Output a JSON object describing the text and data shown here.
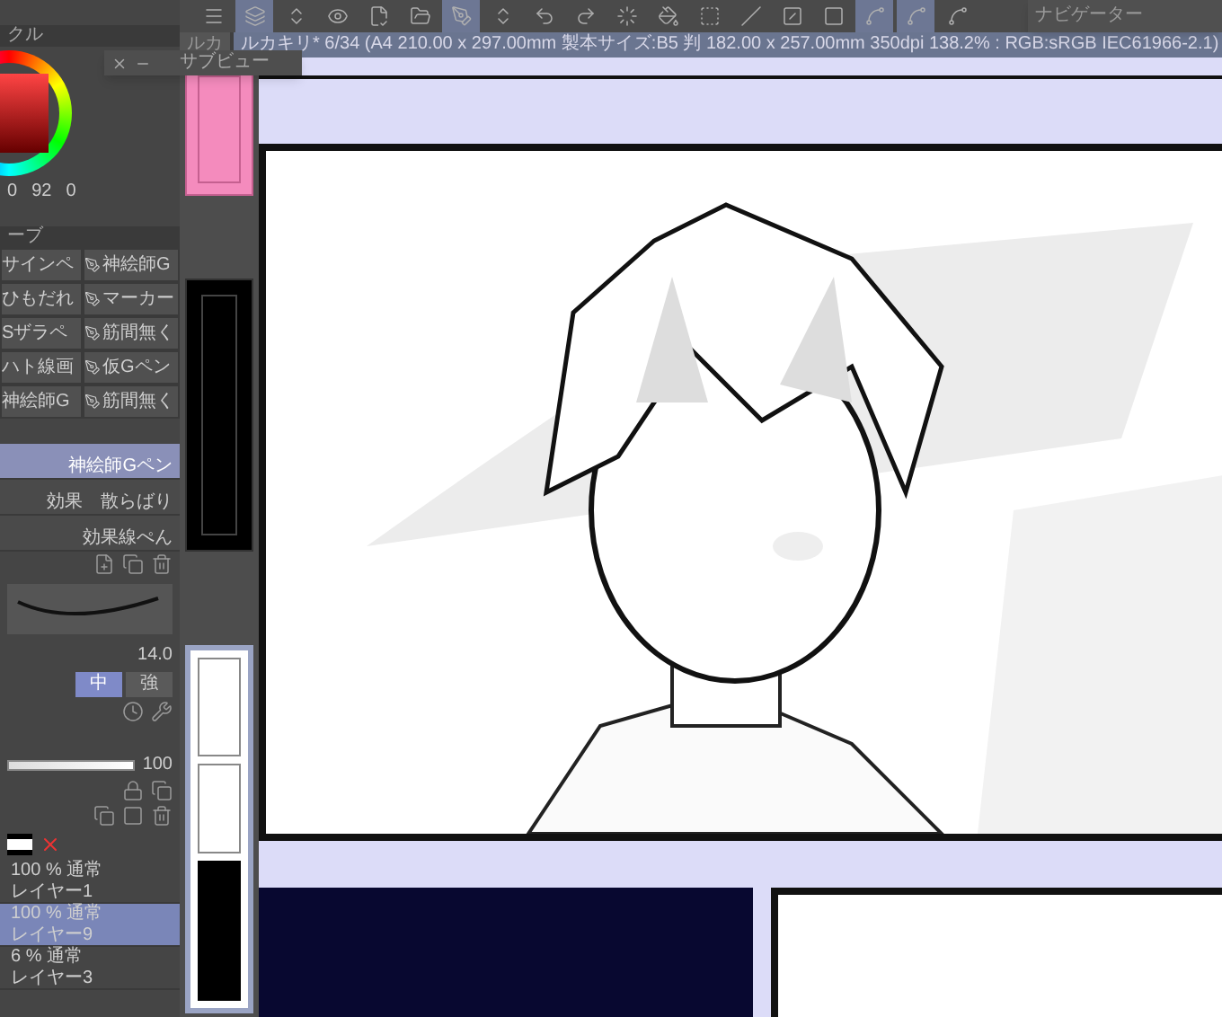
{
  "toolbar": {
    "tools": [
      {
        "kind": "menu",
        "selected": false
      },
      {
        "kind": "layers",
        "selected": true
      },
      {
        "kind": "updown",
        "selected": false
      },
      {
        "kind": "eye",
        "selected": false
      },
      {
        "kind": "file",
        "selected": false
      },
      {
        "kind": "folder",
        "selected": false
      },
      {
        "kind": "pen",
        "selected": true
      },
      {
        "kind": "updown",
        "selected": false
      },
      {
        "kind": "undo",
        "selected": false
      },
      {
        "kind": "redo",
        "selected": false
      },
      {
        "kind": "loader",
        "selected": false
      },
      {
        "kind": "bucket",
        "selected": false
      },
      {
        "kind": "selectbox",
        "selected": false
      },
      {
        "kind": "slash",
        "selected": false
      },
      {
        "kind": "halfsquare",
        "selected": false
      },
      {
        "kind": "square",
        "selected": false
      },
      {
        "kind": "ruler",
        "selected": true
      },
      {
        "kind": "ruler",
        "selected": true
      },
      {
        "kind": "ruler",
        "selected": false
      }
    ]
  },
  "navigator": {
    "title": "ナビゲーター"
  },
  "tabs": [
    {
      "label": "ルカ",
      "selected": false
    },
    {
      "label": "ルカキリ* 6/34 (A4 210.00 x 297.00mm 製本サイズ:B5 判 182.00 x 257.00mm 350dpi 138.2% : RGB:sRGB IEC61966-2.1)",
      "selected": true
    }
  ],
  "subview": {
    "title": "サブビュー"
  },
  "color_panel": {
    "tab": "クル",
    "values": [
      "0",
      "92",
      "0"
    ]
  },
  "brush_panel": {
    "tab": "ーブ",
    "grid": [
      {
        "label": "サインペ",
        "selected": false
      },
      {
        "label": "神絵師G",
        "selected": false
      },
      {
        "label": "ひもだれ",
        "selected": false
      },
      {
        "label": "マーカー",
        "selected": false
      },
      {
        "label": "Sザラペ",
        "selected": false
      },
      {
        "label": "筋間無く",
        "selected": false
      },
      {
        "label": "ハト線画",
        "selected": false
      },
      {
        "label": "仮Gペン",
        "selected": false
      },
      {
        "label": "神絵師G",
        "selected": false
      },
      {
        "label": "筋間無く",
        "selected": false
      }
    ],
    "list": [
      {
        "label": "神絵師Gペン",
        "selected": true
      },
      {
        "label": "効果　散らばり",
        "selected": false
      },
      {
        "label": "効果線ぺん",
        "selected": false
      }
    ]
  },
  "tool_property": {
    "size": "14.0",
    "strengths": [
      {
        "label": "中",
        "selected": true
      },
      {
        "label": "強",
        "selected": false
      }
    ]
  },
  "layer_panel": {
    "opacity": "100",
    "opacity_slider": {
      "level": 1
    },
    "layers": [
      {
        "mode": "100 % 通常",
        "name": "レイヤー1",
        "selected": false
      },
      {
        "mode": "100 % 通常",
        "name": "レイヤー9",
        "selected": true
      },
      {
        "mode": "6 % 通常",
        "name": "レイヤー3",
        "selected": false
      }
    ]
  }
}
